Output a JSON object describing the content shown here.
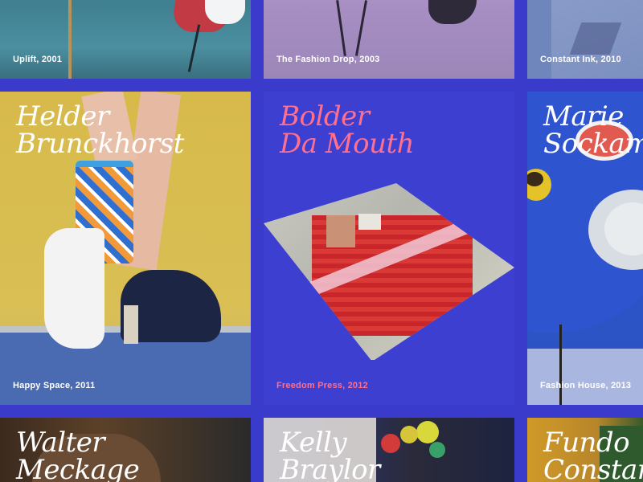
{
  "colors": {
    "background": "#3a3acb",
    "accent_text": "#ff6f8e",
    "text": "#ffffff"
  },
  "cards": [
    {
      "caption": "Uplift, 2001"
    },
    {
      "caption": "The Fashion Drop, 2003"
    },
    {
      "caption": "Constant Ink, 2010"
    },
    {
      "name": "Helder\nBrunckhorst",
      "caption": "Happy Space, 2011"
    },
    {
      "name": "Bolder\nDa Mouth",
      "caption": "Freedom Press, 2012"
    },
    {
      "name": "Marie\nSockamo",
      "caption": "Fashion House, 2013"
    },
    {
      "name": "Walter\nMeckage"
    },
    {
      "name": "Kelly\nBraylor"
    },
    {
      "name": "Fundo\nConstan"
    }
  ]
}
